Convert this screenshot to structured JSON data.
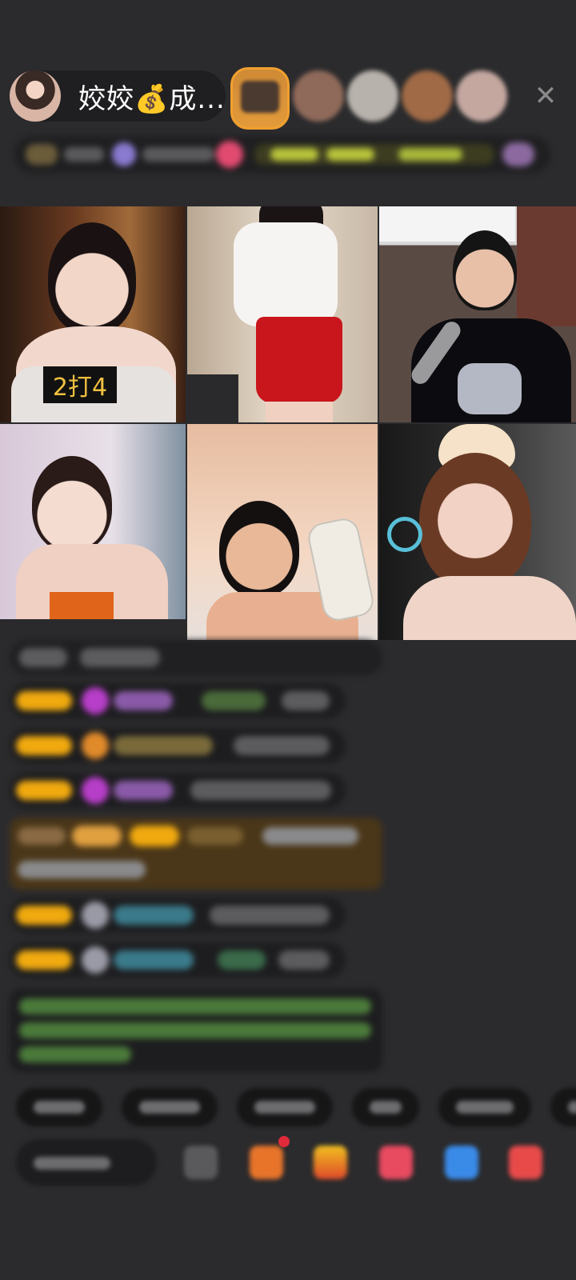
{
  "header": {
    "host_name": "姣姣💰成..."
  },
  "video_grid": {
    "tiles": [
      {
        "badge": "2打4"
      },
      {
        "badge": ""
      },
      {
        "badge": ""
      },
      {
        "badge": ""
      },
      {
        "badge": ""
      },
      {
        "badge": ""
      }
    ]
  },
  "colors": {
    "background": "#2b2b2d",
    "pill": "#1f1f21",
    "badge_gold": "#f0a90f",
    "score_text": "#f0c040"
  },
  "icons": [
    "avatar",
    "close-icon",
    "gift-icon",
    "cart-icon",
    "share-icon"
  ]
}
